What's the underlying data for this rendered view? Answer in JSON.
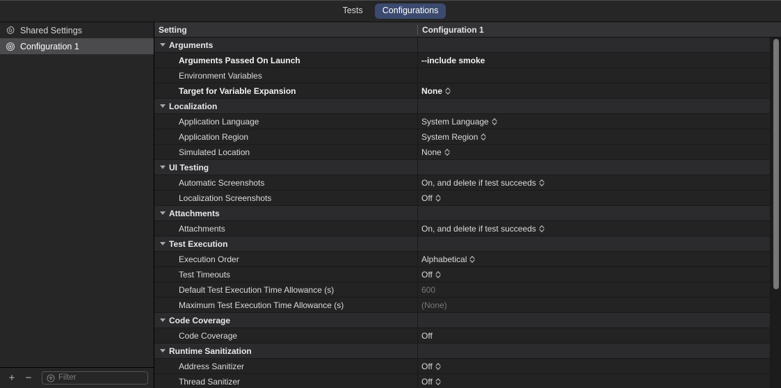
{
  "tabs": [
    {
      "label": "Tests",
      "selected": false
    },
    {
      "label": "Configurations",
      "selected": true
    }
  ],
  "sidebar": {
    "items": [
      {
        "label": "Shared Settings",
        "icon": "gear-icon",
        "selected": false
      },
      {
        "label": "Configuration 1",
        "icon": "target-icon",
        "selected": true
      }
    ],
    "footer": {
      "add_label": "+",
      "remove_label": "−",
      "filter_placeholder": "Filter",
      "filter_value": "",
      "filter_icon": "filter-icon"
    }
  },
  "table": {
    "columns": [
      "Setting",
      "Configuration 1"
    ],
    "rows": [
      {
        "type": "group",
        "name": "Arguments"
      },
      {
        "type": "item",
        "name": "Arguments Passed On Launch",
        "value": "--include smoke",
        "modified": true,
        "stepper": false,
        "dim": false
      },
      {
        "type": "item",
        "name": "Environment Variables",
        "value": "",
        "modified": false,
        "stepper": false,
        "dim": false
      },
      {
        "type": "item",
        "name": "Target for Variable Expansion",
        "value": "None",
        "modified": true,
        "stepper": true,
        "dim": false
      },
      {
        "type": "group",
        "name": "Localization"
      },
      {
        "type": "item",
        "name": "Application Language",
        "value": "System Language",
        "modified": false,
        "stepper": true,
        "dim": false
      },
      {
        "type": "item",
        "name": "Application Region",
        "value": "System Region",
        "modified": false,
        "stepper": true,
        "dim": false
      },
      {
        "type": "item",
        "name": "Simulated Location",
        "value": "None",
        "modified": false,
        "stepper": true,
        "dim": false
      },
      {
        "type": "group",
        "name": "UI Testing"
      },
      {
        "type": "item",
        "name": "Automatic Screenshots",
        "value": "On, and delete if test succeeds",
        "modified": false,
        "stepper": true,
        "dim": false
      },
      {
        "type": "item",
        "name": "Localization Screenshots",
        "value": "Off",
        "modified": false,
        "stepper": true,
        "dim": false
      },
      {
        "type": "group",
        "name": "Attachments"
      },
      {
        "type": "item",
        "name": "Attachments",
        "value": "On, and delete if test succeeds",
        "modified": false,
        "stepper": true,
        "dim": false
      },
      {
        "type": "group",
        "name": "Test Execution"
      },
      {
        "type": "item",
        "name": "Execution Order",
        "value": "Alphabetical",
        "modified": false,
        "stepper": true,
        "dim": false
      },
      {
        "type": "item",
        "name": "Test Timeouts",
        "value": "Off",
        "modified": false,
        "stepper": true,
        "dim": false
      },
      {
        "type": "item",
        "name": "Default Test Execution Time Allowance (s)",
        "value": "600",
        "modified": false,
        "stepper": false,
        "dim": true
      },
      {
        "type": "item",
        "name": "Maximum Test Execution Time Allowance (s)",
        "value": "(None)",
        "modified": false,
        "stepper": false,
        "dim": true
      },
      {
        "type": "group",
        "name": "Code Coverage"
      },
      {
        "type": "item",
        "name": "Code Coverage",
        "value": "Off",
        "modified": false,
        "stepper": false,
        "dim": false
      },
      {
        "type": "group",
        "name": "Runtime Sanitization"
      },
      {
        "type": "item",
        "name": "Address Sanitizer",
        "value": "Off",
        "modified": false,
        "stepper": true,
        "dim": false
      },
      {
        "type": "item",
        "name": "Thread Sanitizer",
        "value": "Off",
        "modified": false,
        "stepper": true,
        "dim": false
      }
    ]
  },
  "colors": {
    "accent_selected_tab": "#3b4a6e",
    "sidebar_selection": "#4b4b4d",
    "group_row": "#2b2b2d",
    "item_row": "#232324",
    "header_row": "#333335",
    "dim_text": "#78787a"
  }
}
